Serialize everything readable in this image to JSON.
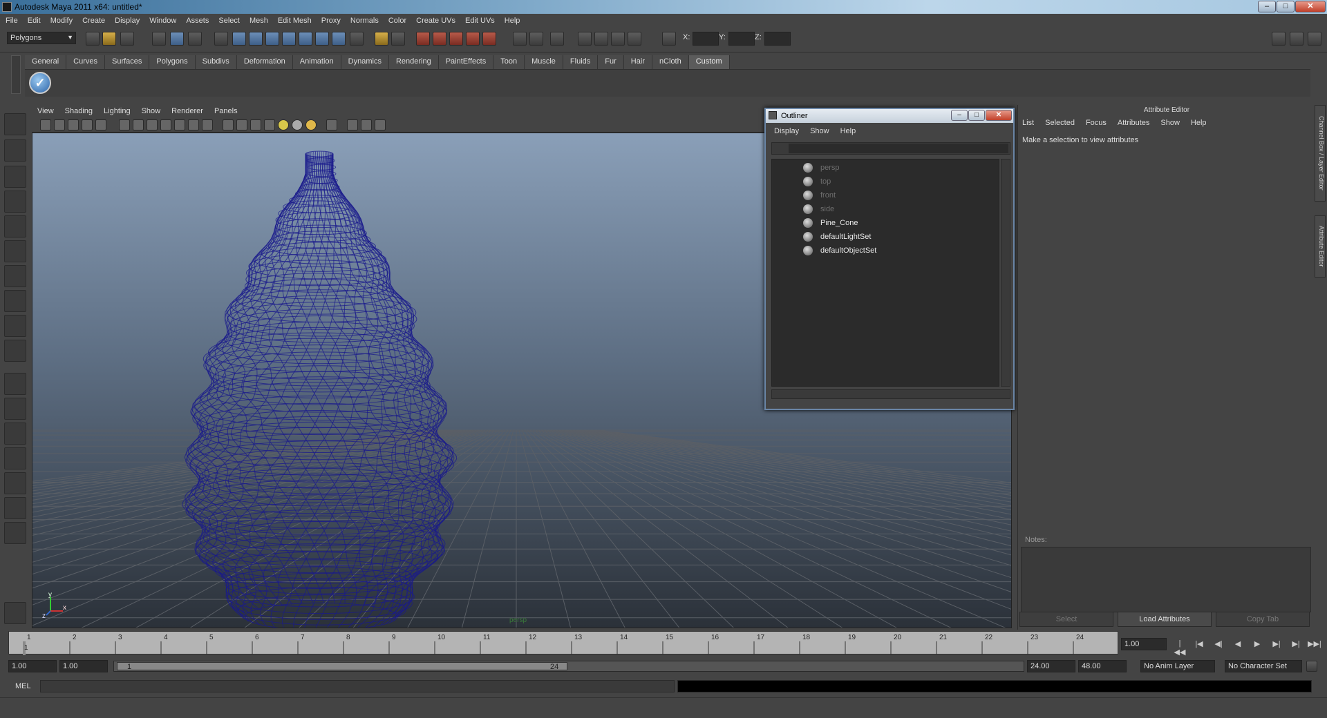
{
  "window": {
    "title": "Autodesk Maya 2011 x64: untitled*",
    "min": "–",
    "max": "□",
    "close": "✕"
  },
  "menubar": [
    "File",
    "Edit",
    "Modify",
    "Create",
    "Display",
    "Window",
    "Assets",
    "Select",
    "Mesh",
    "Edit Mesh",
    "Proxy",
    "Normals",
    "Color",
    "Create UVs",
    "Edit UVs",
    "Help"
  ],
  "statusline": {
    "menu_set": "Polygons",
    "x_label": "X:",
    "y_label": "Y:",
    "z_label": "Z:"
  },
  "shelf": {
    "tabs": [
      "General",
      "Curves",
      "Surfaces",
      "Polygons",
      "Subdivs",
      "Deformation",
      "Animation",
      "Dynamics",
      "Rendering",
      "PaintEffects",
      "Toon",
      "Muscle",
      "Fluids",
      "Fur",
      "Hair",
      "nCloth",
      "Custom"
    ],
    "active_tab": "Custom"
  },
  "viewport": {
    "menu": [
      "View",
      "Shading",
      "Lighting",
      "Show",
      "Renderer",
      "Panels"
    ],
    "camera_label": "persp",
    "mesh_color": "#1a1a8c",
    "axis": {
      "y": "y",
      "x": "x",
      "z": "z"
    }
  },
  "outliner": {
    "title": "Outliner",
    "menu": [
      "Display",
      "Show",
      "Help"
    ],
    "items": [
      {
        "label": "persp",
        "dim": true
      },
      {
        "label": "top",
        "dim": true
      },
      {
        "label": "front",
        "dim": true
      },
      {
        "label": "side",
        "dim": true
      },
      {
        "label": "Pine_Cone",
        "dim": false
      },
      {
        "label": "defaultLightSet",
        "dim": false
      },
      {
        "label": "defaultObjectSet",
        "dim": false
      }
    ]
  },
  "attribute_editor": {
    "title": "Attribute Editor",
    "menu": [
      "List",
      "Selected",
      "Focus",
      "Attributes",
      "Show",
      "Help"
    ],
    "message": "Make a selection to view attributes",
    "notes_label": "Notes:",
    "buttons": {
      "select": "Select",
      "load": "Load Attributes",
      "copy": "Copy Tab"
    },
    "side_tabs": [
      "Channel Box / Layer Editor",
      "Attribute Editor"
    ]
  },
  "time_slider": {
    "ticks": [
      "1",
      "2",
      "3",
      "4",
      "5",
      "6",
      "7",
      "8",
      "9",
      "10",
      "11",
      "12",
      "13",
      "14",
      "15",
      "16",
      "17",
      "18",
      "19",
      "20",
      "21",
      "22",
      "23",
      "24"
    ],
    "current_marker": "1",
    "current_frame": "1.00"
  },
  "range_slider": {
    "start_time": "1.00",
    "playback_start": "1.00",
    "range_start_label": "1",
    "range_end_label": "24",
    "playback_end": "24.00",
    "end_time": "48.00",
    "anim_layer": "No Anim Layer",
    "character_set": "No Character Set"
  },
  "command_line": {
    "mode": "MEL"
  },
  "playback_icons": [
    "|◀◀",
    "|◀",
    "◀|",
    "◀",
    "▶",
    "▶|",
    "▶|",
    "▶▶|"
  ]
}
